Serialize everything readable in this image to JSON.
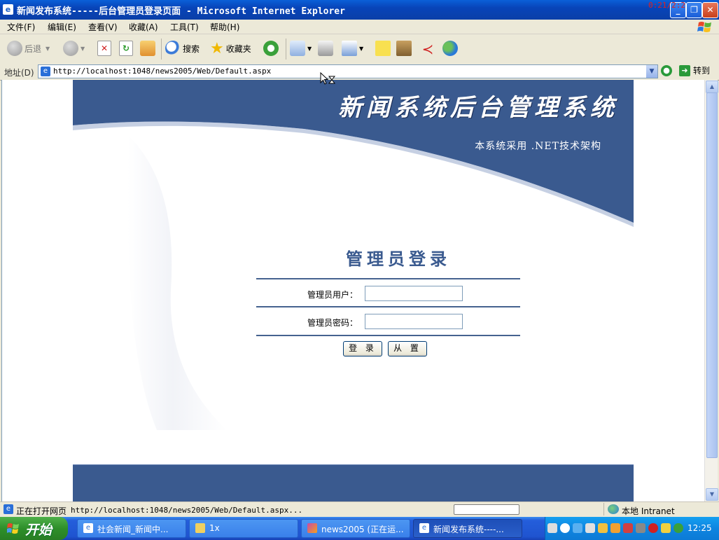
{
  "window": {
    "title": "新闻发布系统-----后台管理员登录页面 - Microsoft Internet Explorer",
    "overlay_clock": "0:21/2:2"
  },
  "menu": [
    "文件(F)",
    "编辑(E)",
    "查看(V)",
    "收藏(A)",
    "工具(T)",
    "帮助(H)"
  ],
  "toolbar": {
    "back": "后退",
    "search": "搜索",
    "favorites": "收藏夹"
  },
  "address": {
    "label": "地址(D)",
    "url": "http://localhost:1048/news2005/Web/Default.aspx",
    "go": "转到"
  },
  "page": {
    "system_title": "新闻系统后台管理系统",
    "subtitle": "本系统采用 .NET技术架构",
    "login_title": "管理员登录",
    "user_label": "管理员用户：",
    "password_label": "管理员密码：",
    "user_value": "",
    "password_value": "",
    "login_button": "登 录",
    "reset_button": "从 置",
    "colors": {
      "header_blue": "#3a5a8f",
      "title_blue": "#3a5a8f"
    }
  },
  "status": {
    "text": "正在打开网页",
    "url": "http://localhost:1048/news2005/Web/Default.aspx...",
    "zone": "本地 Intranet"
  },
  "taskbar": {
    "start": "开始",
    "items": [
      {
        "label": "社会新闻_新闻中...",
        "icon": "ie-icon"
      },
      {
        "label": "1x",
        "icon": "folder-icon"
      },
      {
        "label": "news2005 (正在运...",
        "icon": "vs-icon"
      },
      {
        "label": "新闻发布系统----...",
        "icon": "ie-icon"
      }
    ],
    "clock": "12:25"
  }
}
